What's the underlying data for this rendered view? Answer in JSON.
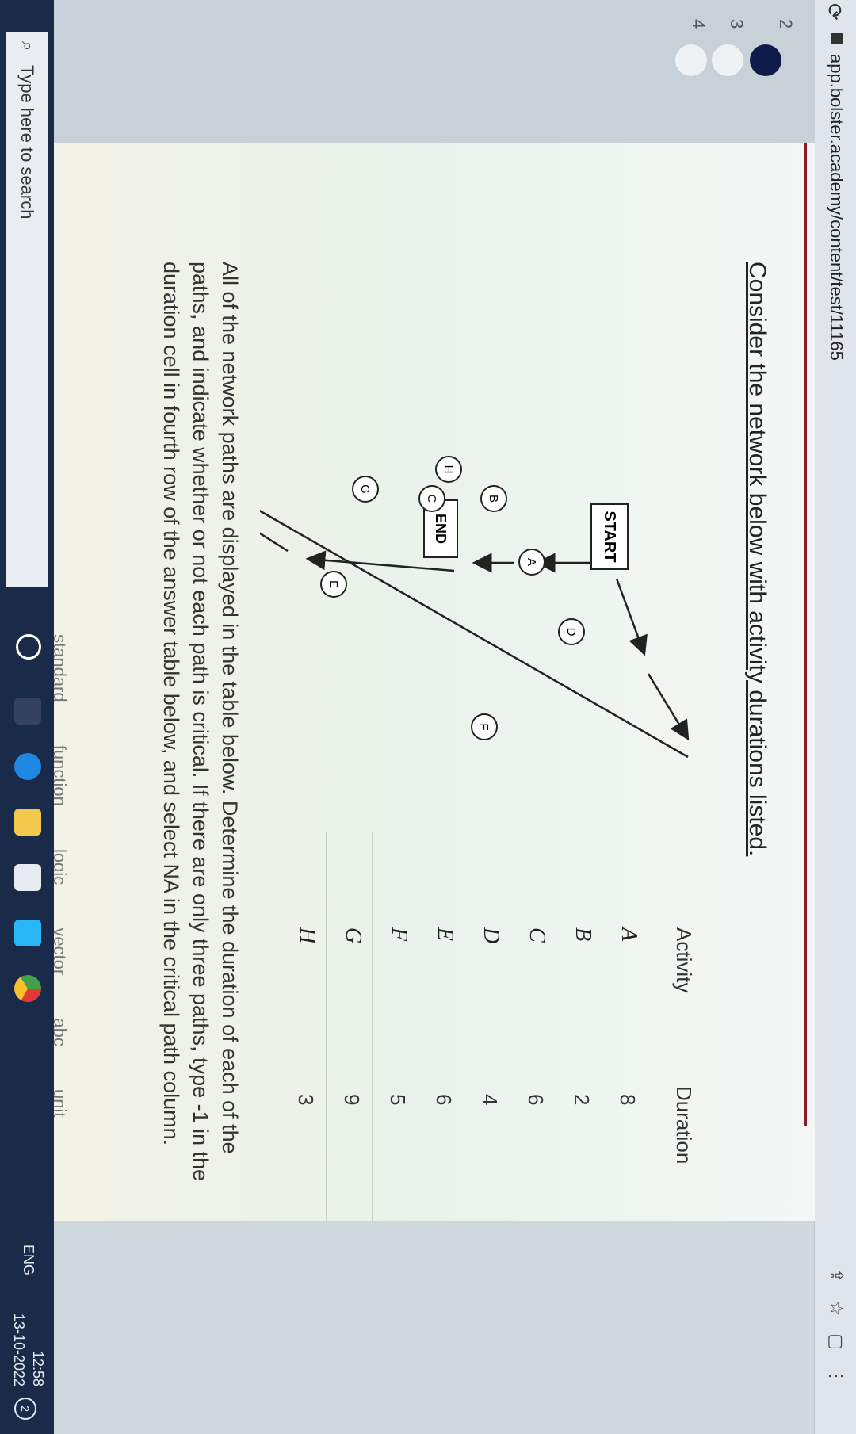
{
  "browser": {
    "url": "app.bolster.academy/content/test/11165"
  },
  "question_nav": {
    "items": [
      "2",
      "3",
      "4"
    ]
  },
  "question": {
    "intro": "Consider the network below with activity durations listed.",
    "instructions": "All of the network paths are displayed in the table below. Determine the duration of each of the paths, and indicate whether or not each path is critical. If there are only three paths, type -1 in the duration cell in fourth row of the answer table below, and select NA in the critical path column."
  },
  "network": {
    "start_label": "START",
    "end_label": "END",
    "nodes": {
      "a": "A",
      "b": "B",
      "c": "C",
      "d": "D",
      "e": "E",
      "f": "F",
      "g": "G",
      "h": "H"
    }
  },
  "table": {
    "headers": {
      "activity": "Activity",
      "duration": "Duration"
    },
    "rows": [
      {
        "activity": "A",
        "duration": "8"
      },
      {
        "activity": "B",
        "duration": "2"
      },
      {
        "activity": "C",
        "duration": "6"
      },
      {
        "activity": "D",
        "duration": "4"
      },
      {
        "activity": "E",
        "duration": "6"
      },
      {
        "activity": "F",
        "duration": "5"
      },
      {
        "activity": "G",
        "duration": "9"
      },
      {
        "activity": "H",
        "duration": "3"
      }
    ]
  },
  "answer_tabs": [
    "standard",
    "function",
    "logic",
    "vector",
    "abc",
    "unit"
  ],
  "taskbar": {
    "search_placeholder": "Type here to search",
    "language": "ENG",
    "time": "12:58",
    "date": "13-10-2022",
    "notification_count": "2"
  },
  "colors": {
    "accent": "#8a1b2c",
    "taskbar": "#1a2b4a",
    "active_question": "#0d1a4a"
  }
}
